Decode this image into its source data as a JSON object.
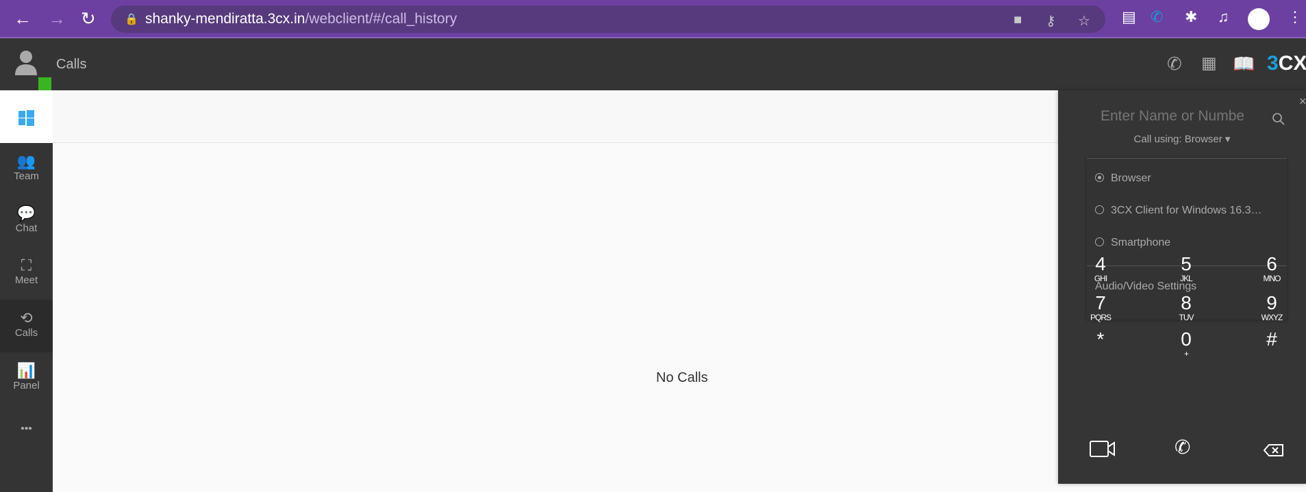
{
  "browser": {
    "url_host": "shanky-mendiratta.3cx.in",
    "url_path": "/webclient/#/call_history"
  },
  "header": {
    "title": "Calls",
    "status_color": "#3ab521",
    "brand_logo": "3CX"
  },
  "sidebar": {
    "items": [
      {
        "label": "Team",
        "icon": "team-icon"
      },
      {
        "label": "Chat",
        "icon": "chat-icon"
      },
      {
        "label": "Meet",
        "icon": "meet-icon"
      },
      {
        "label": "Calls",
        "icon": "history-icon",
        "active": true
      },
      {
        "label": "Panel",
        "icon": "panel-icon"
      }
    ],
    "more": "•••"
  },
  "main": {
    "empty_text": "No Calls"
  },
  "dialer": {
    "search_placeholder": "Enter Name or Number...",
    "call_using": "Call using: Browser ▾",
    "options": [
      {
        "label": "Browser",
        "selected": true
      },
      {
        "label": "3CX Client for Windows 16.3…",
        "selected": false
      },
      {
        "label": "Smartphone",
        "selected": false
      }
    ],
    "settings_label": "Audio/Video Settings",
    "keys": [
      {
        "d": "4",
        "l": "GHI"
      },
      {
        "d": "5",
        "l": "JKL"
      },
      {
        "d": "6",
        "l": "MNO"
      },
      {
        "d": "7",
        "l": "PQRS"
      },
      {
        "d": "8",
        "l": "TUV"
      },
      {
        "d": "9",
        "l": "WXYZ"
      },
      {
        "d": "*",
        "l": ""
      },
      {
        "d": "0",
        "l": "+"
      },
      {
        "d": "#",
        "l": ""
      }
    ]
  }
}
